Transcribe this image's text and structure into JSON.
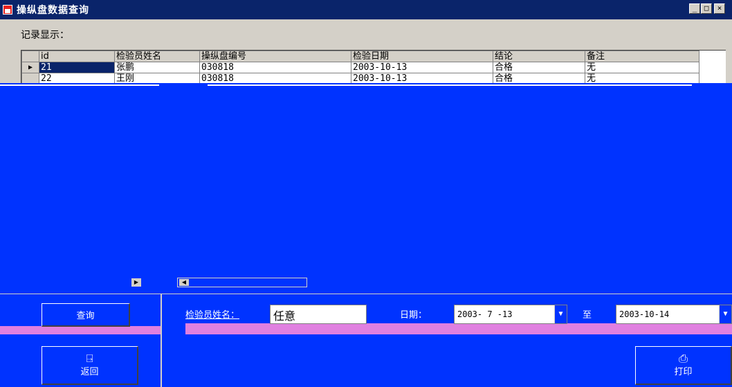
{
  "window": {
    "title": "操纵盘数据查询",
    "controls": [
      "_",
      "□",
      "×"
    ]
  },
  "records_label": "记录显示：",
  "grid": {
    "headers": [
      "id",
      "检验员姓名",
      "操纵盘编号",
      "检验日期",
      "结论",
      "备注"
    ],
    "rows": [
      [
        "21",
        "张鹏",
        "030818",
        "2003-10-13",
        "合格",
        "无"
      ],
      [
        "22",
        "王刚",
        "030818",
        "2003-10-13",
        "合格",
        "无"
      ]
    ]
  },
  "buttons": {
    "query": "查询",
    "return": "返回",
    "print": "打印"
  },
  "filters": {
    "name_label": "检验员姓名：",
    "name_value": "任意",
    "date_label": "日期：",
    "date_from": "2003- 7 -13",
    "to_label": "至",
    "date_to": "2003-10-14"
  },
  "icons": [
    "app-window-icon",
    "door-exit-icon",
    "printer-icon",
    "dropdown-arrow-icon",
    "row-indicator-icon"
  ]
}
